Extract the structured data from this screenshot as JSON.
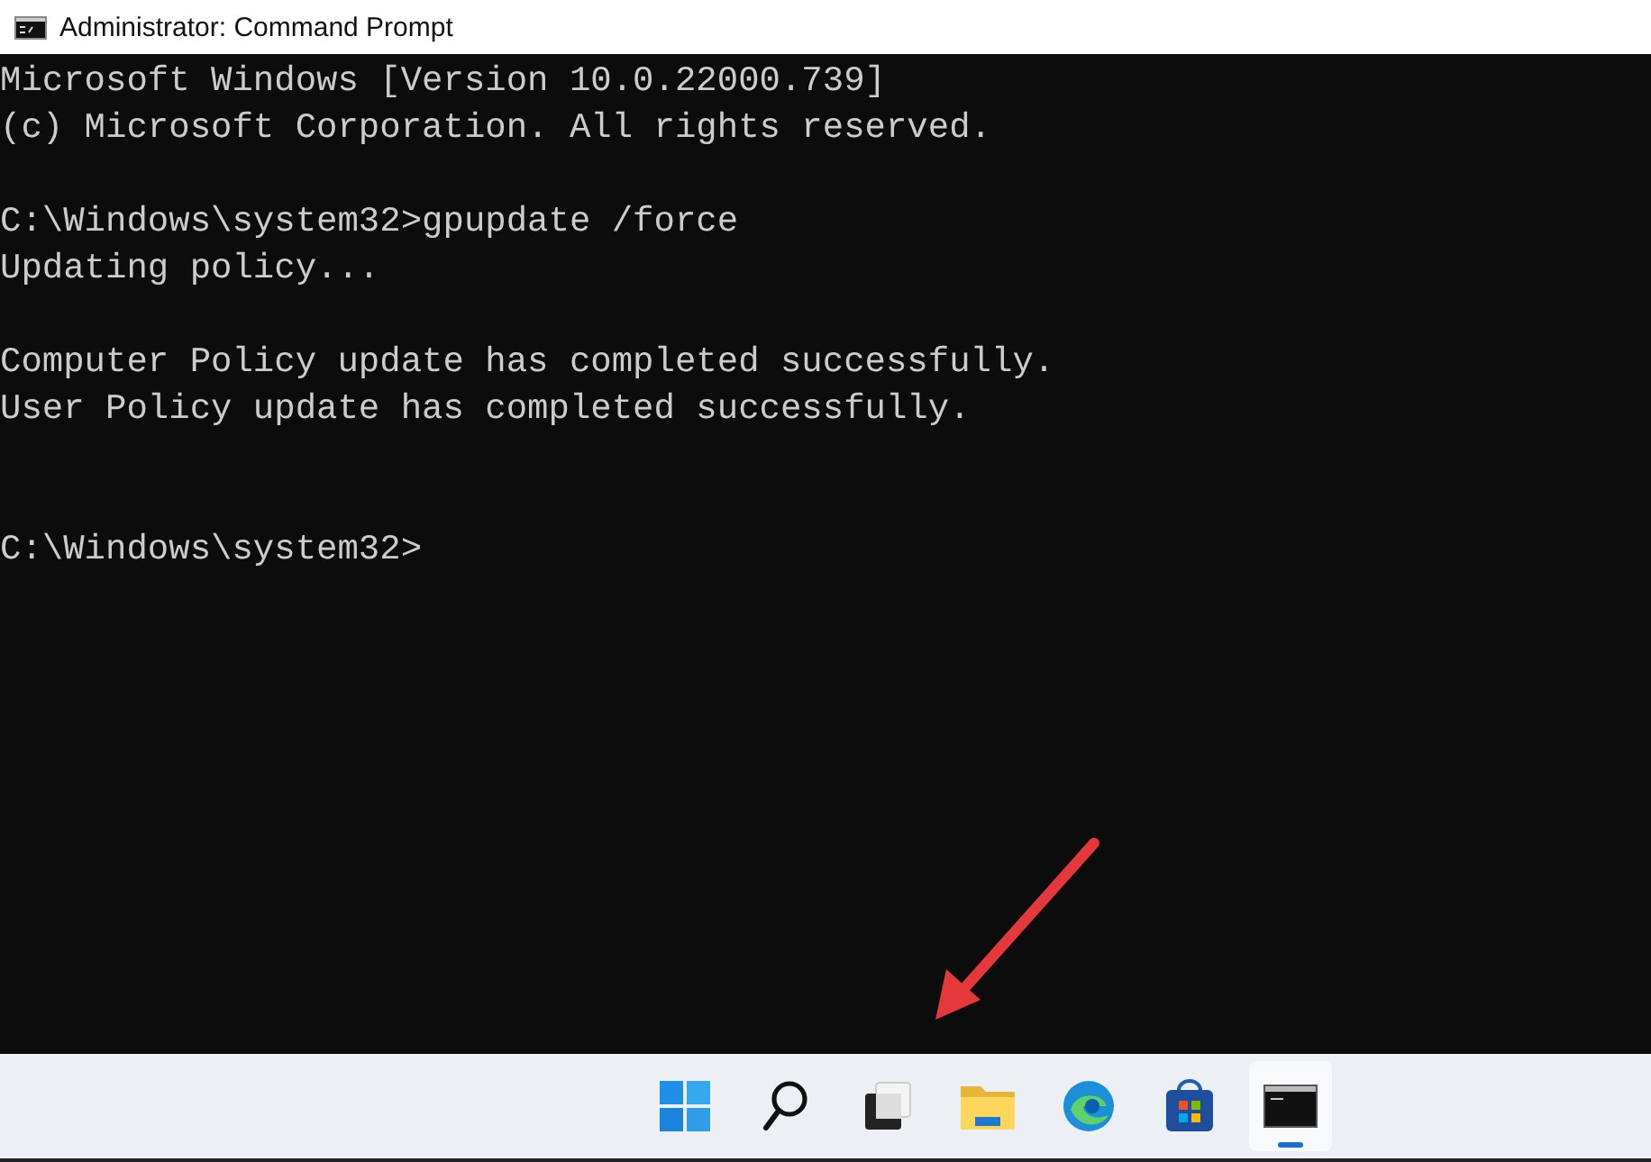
{
  "window": {
    "title": "Administrator: Command Prompt"
  },
  "console": {
    "blocks": [
      {
        "kind": "output",
        "lines": [
          "Microsoft Windows [Version 10.0.22000.739]",
          "(c) Microsoft Corporation. All rights reserved."
        ]
      },
      {
        "kind": "output",
        "lines": [
          "C:\\Windows\\system32>gpupdate /force",
          "Updating policy..."
        ]
      },
      {
        "kind": "output",
        "lines": [
          "Computer Policy update has completed successfully.",
          "User Policy update has completed successfully."
        ]
      },
      {
        "kind": "prompt",
        "lines": [
          "C:\\Windows\\system32>"
        ]
      }
    ]
  },
  "taskbar": {
    "items": [
      {
        "kind": "start",
        "selected": false
      },
      {
        "kind": "search",
        "selected": false
      },
      {
        "kind": "task-view",
        "selected": false
      },
      {
        "kind": "file-explorer",
        "selected": false
      },
      {
        "kind": "browser",
        "selected": false
      },
      {
        "kind": "store",
        "selected": false
      },
      {
        "kind": "terminal",
        "selected": true
      }
    ]
  }
}
